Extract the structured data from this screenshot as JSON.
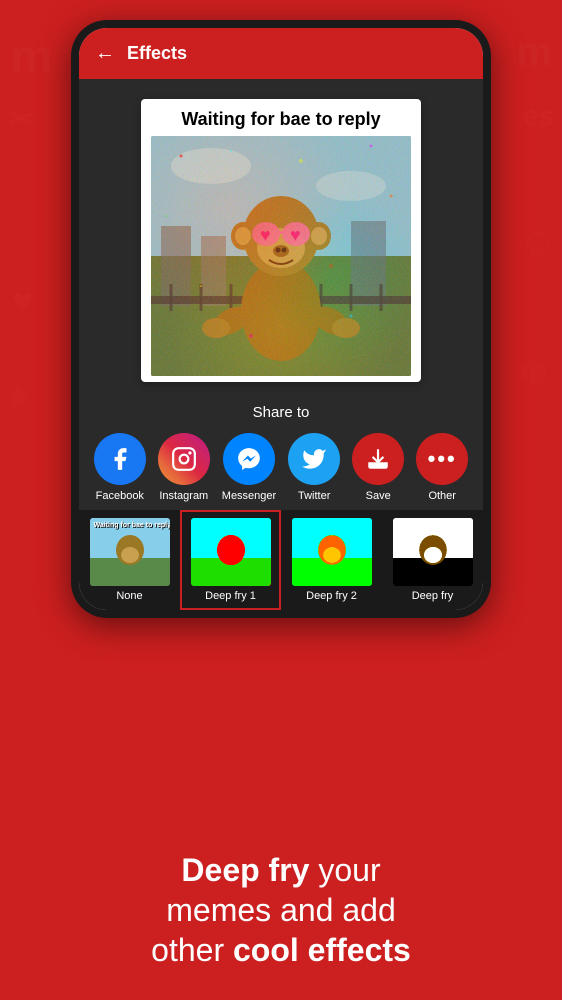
{
  "header": {
    "back_label": "←",
    "title": "Effects"
  },
  "meme": {
    "title_text": "Waiting for bae to reply",
    "image_alt": "monkey with heart sunglasses deep fried"
  },
  "share": {
    "label": "Share to",
    "items": [
      {
        "id": "facebook",
        "label": "Facebook",
        "icon": "facebook-icon",
        "color_class": "icon-facebook"
      },
      {
        "id": "instagram",
        "label": "Instagram",
        "icon": "instagram-icon",
        "color_class": "icon-instagram"
      },
      {
        "id": "messenger",
        "label": "Messenger",
        "icon": "messenger-icon",
        "color_class": "icon-messenger"
      },
      {
        "id": "twitter",
        "label": "Twitter",
        "icon": "twitter-icon",
        "color_class": "icon-twitter"
      },
      {
        "id": "save",
        "label": "Save",
        "icon": "save-icon",
        "color_class": "icon-save"
      },
      {
        "id": "other",
        "label": "Other",
        "icon": "other-icon",
        "color_class": "icon-other"
      }
    ]
  },
  "effects": {
    "items": [
      {
        "id": "none",
        "label": "None",
        "selected": false,
        "thumb_class": "effect-thumb-none"
      },
      {
        "id": "deep_fry_1",
        "label": "Deep fry 1",
        "selected": true,
        "thumb_class": "effect-thumb-df1"
      },
      {
        "id": "deep_fry_2",
        "label": "Deep fry 2",
        "selected": false,
        "thumb_class": "effect-thumb-df2"
      },
      {
        "id": "deep_fry_3",
        "label": "Deep fry",
        "selected": false,
        "thumb_class": "effect-thumb-df3"
      }
    ]
  },
  "tagline": {
    "part1_bold": "Deep fry",
    "part1_normal": " your",
    "line2": "memes and add",
    "part3_normal": "other ",
    "part3_bold": "cool effects"
  },
  "bg_doodles": {
    "left_text": "m",
    "right_top": "es",
    "scissors": "✂",
    "smiley": "☺"
  }
}
